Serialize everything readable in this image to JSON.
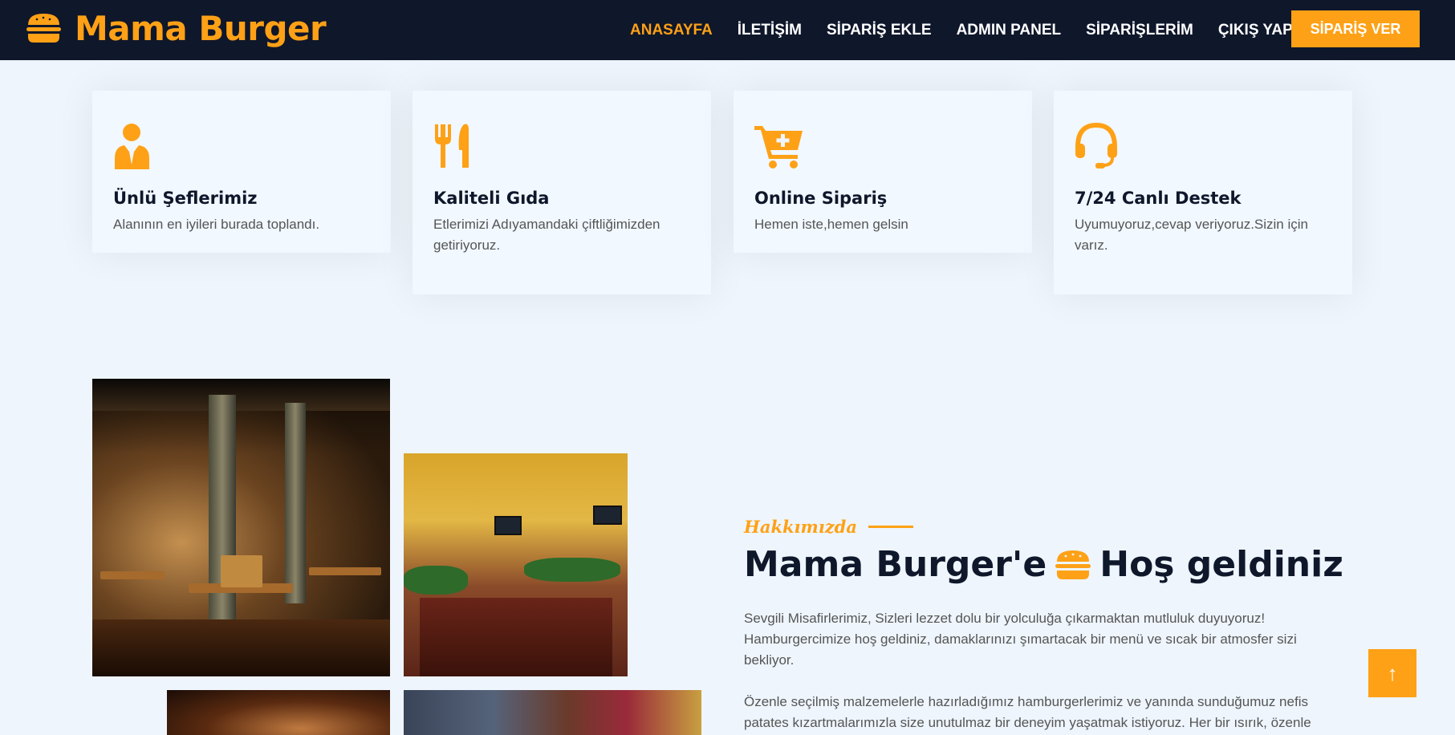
{
  "navbar": {
    "brand": "Mama Burger",
    "links": [
      {
        "label": "ANASAYFA",
        "active": true
      },
      {
        "label": "İLETİŞİM",
        "active": false
      },
      {
        "label": "SİPARİŞ EKLE",
        "active": false
      },
      {
        "label": "ADMIN PANEL",
        "active": false
      },
      {
        "label": "SİPARİŞLERİM",
        "active": false
      },
      {
        "label": "ÇIKIŞ YAP",
        "active": false
      }
    ],
    "order_button": "SİPARİŞ VER"
  },
  "services": [
    {
      "icon": "chef-icon",
      "title": "Ünlü Şeflerimiz",
      "text": "Alanının en iyileri burada toplandı."
    },
    {
      "icon": "utensils-icon",
      "title": "Kaliteli Gıda",
      "text": "Etlerimizi Adıyamandaki çiftliğimizden getiriyoruz."
    },
    {
      "icon": "cart-plus-icon",
      "title": "Online Sipariş",
      "text": "Hemen iste,hemen gelsin"
    },
    {
      "icon": "headset-icon",
      "title": "7/24 Canlı Destek",
      "text": "Uyumuyoruz,cevap veriyoruz.Sizin için varız."
    }
  ],
  "about": {
    "subtitle": "Hakkımızda",
    "title_before": "Mama Burger'e",
    "title_after": "Hoş geldiniz",
    "paragraph_1": "Sevgili Misafirlerimiz, Sizleri lezzet dolu bir yolculuğa çıkarmaktan mutluluk duyuyoruz! Hamburgercimize hoş geldiniz, damaklarınızı şımartacak bir menü ve sıcak bir atmosfer sizi bekliyor.",
    "paragraph_2": "Özenle seçilmiş malzemelerle hazırladığımız hamburgerlerimiz ve yanında sunduğumuz nefis patates kızartmalarımızla size unutulmaz bir deneyim yaşatmak istiyoruz. Her bir ısırık, özenle"
  },
  "back_to_top": "↑",
  "colors": {
    "accent": "#fea116",
    "dark": "#0f172b",
    "background": "#eef5fc"
  }
}
